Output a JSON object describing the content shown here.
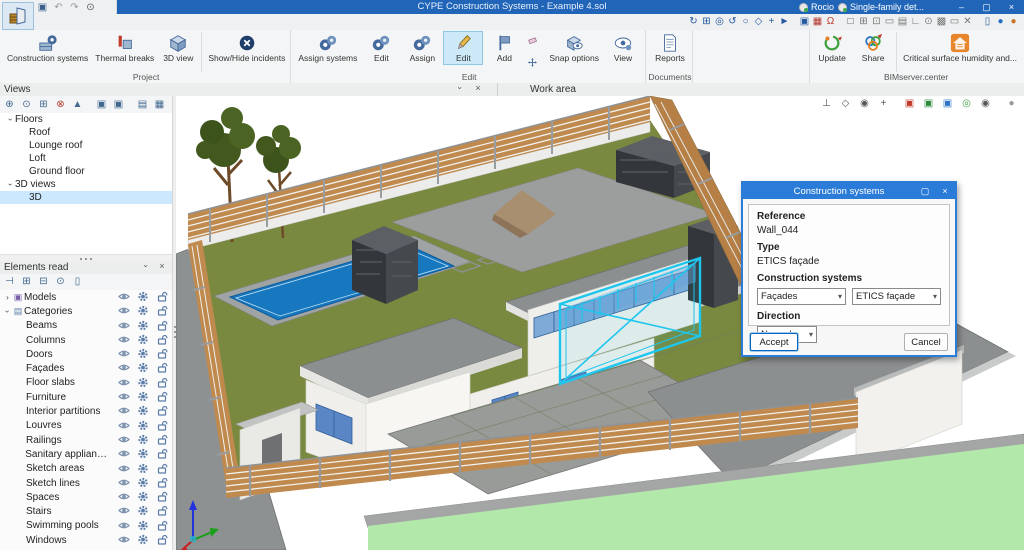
{
  "window": {
    "title": "CYPE Construction Systems - Example 4.sol",
    "user": "Rocio",
    "project": "Single-family det...",
    "minimize": "–",
    "maximize": "▢",
    "close": "×"
  },
  "quick_access": {
    "icons": [
      {
        "n": "save-icon",
        "g": "▣",
        "c": "#3a5f8a"
      },
      {
        "n": "undo-icon",
        "g": "↶",
        "c": "#9a9a9a"
      },
      {
        "n": "redo-icon",
        "g": "↷",
        "c": "#9a9a9a"
      },
      {
        "n": "search-icon",
        "g": "⊙",
        "c": "#555"
      }
    ]
  },
  "toolbar2": {
    "icons": [
      {
        "n": "redraw-icon",
        "g": "↻",
        "c": "#2458a0"
      },
      {
        "n": "zoom-window-icon",
        "g": "⊞",
        "c": "#2458a0"
      },
      {
        "n": "zoom-extents-icon",
        "g": "◎",
        "c": "#2458a0"
      },
      {
        "n": "orbit-icon",
        "g": "↺",
        "c": "#2458a0"
      },
      {
        "n": "zoom-previous-icon",
        "g": "○",
        "c": "#2458a0"
      },
      {
        "n": "pan-icon",
        "g": "◇",
        "c": "#2458a0"
      },
      {
        "n": "move-view-icon",
        "g": "+",
        "c": "#2458a0"
      },
      {
        "n": "pointer-icon",
        "g": "►",
        "c": "#2458a0"
      },
      {
        "n": "capture-window-icon",
        "g": "▣",
        "c": "#2458a0",
        "sep": true
      },
      {
        "n": "red-grid-icon",
        "g": "▦",
        "c": "#b3342c"
      },
      {
        "n": "magnet-snap-icon",
        "g": "Ω",
        "c": "#c03a2e"
      },
      {
        "n": "ortho-icon",
        "g": "□",
        "c": "#555",
        "sep": true
      },
      {
        "n": "grid-icon",
        "g": "⊞",
        "c": "#777"
      },
      {
        "n": "point-snap-icon",
        "g": "⊡",
        "c": "#777"
      },
      {
        "n": "screen-icon",
        "g": "▭",
        "c": "#777"
      },
      {
        "n": "layout-icon",
        "g": "▤",
        "c": "#777"
      },
      {
        "n": "angle-icon",
        "g": "∟",
        "c": "#777"
      },
      {
        "n": "clock-icon",
        "g": "⊙",
        "c": "#777"
      },
      {
        "n": "clipboard-icon",
        "g": "▩",
        "c": "#777"
      },
      {
        "n": "comment-icon",
        "g": "▭",
        "c": "#777"
      },
      {
        "n": "tools-icon",
        "g": "✕",
        "c": "#777"
      },
      {
        "n": "split-view-icon",
        "g": "▯",
        "c": "#345f9e",
        "sep": true
      },
      {
        "n": "globe-icon",
        "g": "●",
        "c": "#2b6fc2"
      },
      {
        "n": "help-icon",
        "g": "●",
        "c": "#c8762a"
      }
    ]
  },
  "ribbon": {
    "groups": [
      {
        "label": "Project",
        "buttons": [
          {
            "label": "Construction systems",
            "icon": "construction-systems-icon"
          },
          {
            "label": "Thermal breaks",
            "icon": "thermal-breaks-icon"
          },
          {
            "label": "3D view",
            "icon": "cube-icon"
          },
          {
            "label": "Show/Hide incidents",
            "icon": "incidents-icon",
            "sep_before": true
          }
        ]
      },
      {
        "label": "Edit",
        "buttons": [
          {
            "label": "Assign systems",
            "icon": "assign-systems-icon"
          },
          {
            "label": "Edit",
            "icon": "edit-systems-icon"
          },
          {
            "label": "Assign",
            "icon": "assign-icon"
          },
          {
            "label": "Edit",
            "icon": "pencil-icon",
            "selected": true
          },
          {
            "label": "Add",
            "icon": "flag-icon"
          },
          {
            "label": "",
            "icon": "eraser-icon",
            "small": true
          },
          {
            "label": "",
            "icon": "move-icon",
            "small": true
          },
          {
            "label": "Snap options",
            "icon": "snap-options-icon"
          },
          {
            "label": "View",
            "icon": "eye-gear-icon"
          }
        ]
      },
      {
        "label": "Documents",
        "buttons": [
          {
            "label": "Reports",
            "icon": "reports-icon"
          }
        ]
      },
      {
        "label": "BIMserver.center",
        "right": true,
        "buttons": [
          {
            "label": "Update",
            "icon": "update-icon"
          },
          {
            "label": "Share",
            "icon": "share-icon"
          },
          {
            "label": "Critical surface humidity and...",
            "icon": "critical-surface-icon",
            "wide": true,
            "sep_before": true
          }
        ]
      }
    ]
  },
  "views_panel": {
    "title": "Views",
    "toolbar": [
      {
        "n": "new-view-icon",
        "g": "⊕",
        "c": "#40688f"
      },
      {
        "n": "edit-view-icon",
        "g": "⊙",
        "c": "#40688f"
      },
      {
        "n": "duplicate-view-icon",
        "g": "⊞",
        "c": "#40688f"
      },
      {
        "n": "delete-view-icon",
        "g": "⊗",
        "c": "#b33a2e"
      },
      {
        "n": "perspective-view-icon",
        "g": "▲",
        "c": "#40688f"
      },
      {
        "n": "snapshot-icon",
        "g": "▣",
        "c": "#40688f",
        "sep": true
      },
      {
        "n": "snapshot-copy-icon",
        "g": "▣",
        "c": "#40688f"
      },
      {
        "n": "box-open-icon",
        "g": "▤",
        "c": "#40688f",
        "sep": true
      },
      {
        "n": "box-closed-icon",
        "g": "▦",
        "c": "#40688f"
      }
    ],
    "tree": [
      {
        "label": "Floors",
        "level": 0,
        "expanded": true
      },
      {
        "label": "Roof",
        "level": 1
      },
      {
        "label": "Lounge roof",
        "level": 1
      },
      {
        "label": "Loft",
        "level": 1
      },
      {
        "label": "Ground floor",
        "level": 1
      },
      {
        "label": "3D views",
        "level": 0,
        "expanded": true
      },
      {
        "label": "3D",
        "level": 1,
        "selected": true
      }
    ]
  },
  "elements_panel": {
    "title": "Elements read",
    "toolbar": [
      {
        "n": "collapse-icon",
        "g": "⊣",
        "c": "#40688f"
      },
      {
        "n": "table-icon",
        "g": "⊞",
        "c": "#40688f"
      },
      {
        "n": "table-add-icon",
        "g": "⊟",
        "c": "#40688f"
      },
      {
        "n": "search-settings-icon",
        "g": "⊙",
        "c": "#40688f"
      },
      {
        "n": "filter-icon",
        "g": "▯",
        "c": "#40688f"
      }
    ],
    "tree": [
      {
        "label": "Models",
        "level": 0,
        "expanded": false,
        "icon": "▣",
        "icon_color": "#7a5fa8"
      },
      {
        "label": "Categories",
        "level": 0,
        "expanded": true,
        "icon": "▤",
        "icon_color": "#5b7ca8"
      },
      {
        "label": "Beams",
        "level": 1
      },
      {
        "label": "Columns",
        "level": 1
      },
      {
        "label": "Doors",
        "level": 1
      },
      {
        "label": "Façades",
        "level": 1
      },
      {
        "label": "Floor slabs",
        "level": 1
      },
      {
        "label": "Furniture",
        "level": 1
      },
      {
        "label": "Interior partitions",
        "level": 1
      },
      {
        "label": "Louvres",
        "level": 1
      },
      {
        "label": "Railings",
        "level": 1
      },
      {
        "label": "Sanitary appliances",
        "level": 1
      },
      {
        "label": "Sketch areas",
        "level": 1
      },
      {
        "label": "Sketch lines",
        "level": 1
      },
      {
        "label": "Spaces",
        "level": 1
      },
      {
        "label": "Stairs",
        "level": 1
      },
      {
        "label": "Swimming pools",
        "level": 1
      },
      {
        "label": "Windows",
        "level": 1
      }
    ]
  },
  "work_area": {
    "label": "Work area",
    "viewport_toolbar": [
      {
        "n": "axes-icon",
        "g": "⊥",
        "c": "#555"
      },
      {
        "n": "cube-view-icon",
        "g": "◇",
        "c": "#556"
      },
      {
        "n": "orbit-view-icon",
        "g": "◉",
        "c": "#555"
      },
      {
        "n": "pan-3d-icon",
        "g": "+",
        "c": "#555"
      },
      {
        "n": "section-red-icon",
        "g": "▣",
        "c": "#c0392b",
        "sep": true
      },
      {
        "n": "section-green-icon",
        "g": "▣",
        "c": "#2e8b3a"
      },
      {
        "n": "section-blue-icon",
        "g": "▣",
        "c": "#2e75c8"
      },
      {
        "n": "render-icon",
        "g": "◎",
        "c": "#3fa040"
      },
      {
        "n": "visibility-icon",
        "g": "◉",
        "c": "#555"
      },
      {
        "n": "sphere-icon",
        "g": "●",
        "c": "#999",
        "sep": true
      }
    ]
  },
  "dialog": {
    "title": "Construction systems",
    "maximize": "▢",
    "close": "×",
    "reference_label": "Reference",
    "reference_value": "Wall_044",
    "type_label": "Type",
    "type_value": "ETICS façade",
    "systems_label": "Construction systems",
    "system_family": "Façades",
    "system_type": "ETICS façade",
    "direction_label": "Direction",
    "direction_value": "Normal",
    "accept": "Accept",
    "cancel": "Cancel"
  },
  "colors": {
    "titlebar": "#2065b8",
    "dialog_titlebar": "#2b7cd8",
    "ribbon_selected": "#cde9f7",
    "tree_selected": "#cce8ff",
    "lawn": "#79893f",
    "pool": "#1777bf",
    "selection_cyan": "#1ec6ee",
    "fence_wood": "#c08a4e",
    "verge_green": "#b2e8aa"
  }
}
